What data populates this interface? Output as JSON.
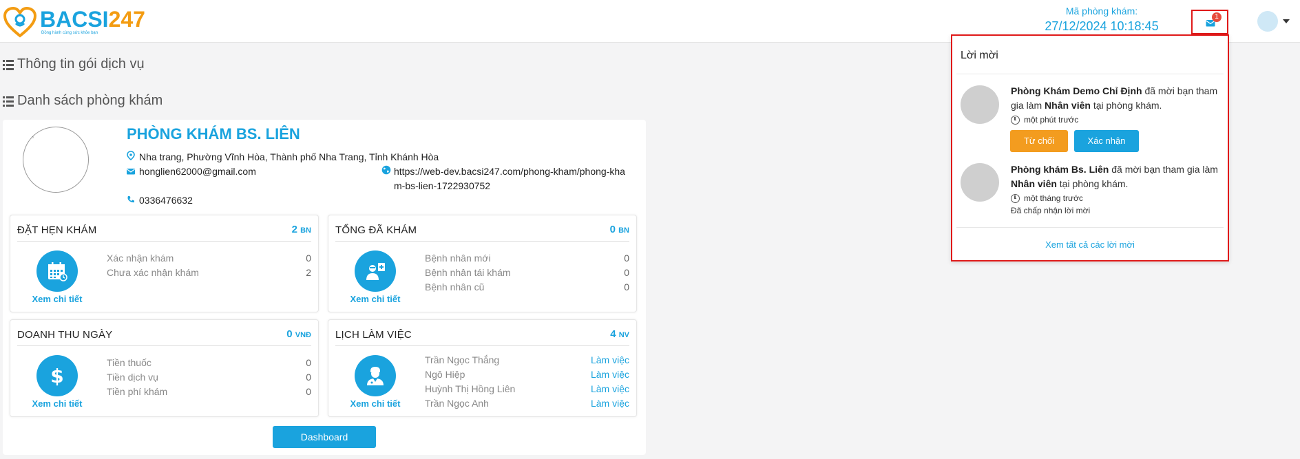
{
  "header": {
    "logo_text": "BACSI247",
    "logo_tagline": "Đồng hành cùng sức khỏe bạn",
    "clinic_code_label": "Mã phòng khám:",
    "datetime": "27/12/2024 10:18:45",
    "notification_count": "1"
  },
  "sections": {
    "service_info": "Thông tin gói dịch vụ",
    "clinic_list": "Danh sách phòng khám"
  },
  "clinic": {
    "name": "PHÒNG KHÁM BS. LIÊN",
    "address": "Nha trang, Phường Vĩnh Hòa, Thành phố Nha Trang, Tỉnh Khánh Hòa",
    "email": "honglien62000@gmail.com",
    "website": "https://web-dev.bacsi247.com/phong-kham/phong-kham-bs-lien-1722930752",
    "phone": "0336476632"
  },
  "stats": {
    "appointments": {
      "title": "ĐẶT HẸN KHÁM",
      "value": "2",
      "unit": "BN",
      "link": "Xem chi tiết",
      "rows": [
        {
          "label": "Xác nhận khám",
          "value": "0"
        },
        {
          "label": "Chưa xác nhận khám",
          "value": "2"
        }
      ]
    },
    "total_exams": {
      "title": "TỔNG ĐÃ KHÁM",
      "value": "0",
      "unit": "BN",
      "link": "Xem chi tiết",
      "rows": [
        {
          "label": "Bệnh nhân mới",
          "value": "0"
        },
        {
          "label": "Bệnh nhân tái khám",
          "value": "0"
        },
        {
          "label": "Bệnh nhân cũ",
          "value": "0"
        }
      ]
    },
    "daily_revenue": {
      "title": "DOANH THU NGÀY",
      "value": "0",
      "unit": "VNĐ",
      "link": "Xem chi tiết",
      "rows": [
        {
          "label": "Tiền thuốc",
          "value": "0"
        },
        {
          "label": "Tiền dịch vụ",
          "value": "0"
        },
        {
          "label": "Tiền phí khám",
          "value": "0"
        }
      ]
    },
    "work_schedule": {
      "title": "LỊCH LÀM VIỆC",
      "value": "4",
      "unit": "NV",
      "link": "Xem chi tiết",
      "rows": [
        {
          "label": "Trần Ngọc Thắng",
          "value": "Làm việc"
        },
        {
          "label": "Ngô Hiệp",
          "value": "Làm việc"
        },
        {
          "label": "Huỳnh Thị Hồng Liên",
          "value": "Làm việc"
        },
        {
          "label": "Trần Ngọc Anh",
          "value": "Làm việc"
        }
      ]
    }
  },
  "dashboard_button": "Dashboard",
  "invites": {
    "title": "Lời mời",
    "items": [
      {
        "clinic": "Phòng Khám Demo Chỉ Định",
        "text_before": " đã mời bạn tham gia làm ",
        "role": "Nhân viên",
        "text_after": " tại phòng khám.",
        "time": "một phút trước",
        "reject": "Từ chối",
        "accept": "Xác nhận"
      },
      {
        "clinic": "Phòng khám Bs. Liên",
        "text_before": " đã mời bạn tham gia làm ",
        "role": "Nhân viên",
        "text_after": " tại phòng khám.",
        "time": "một tháng trước",
        "status": "Đã chấp nhận lời mời"
      }
    ],
    "view_all": "Xem tất cả các lời mời"
  }
}
